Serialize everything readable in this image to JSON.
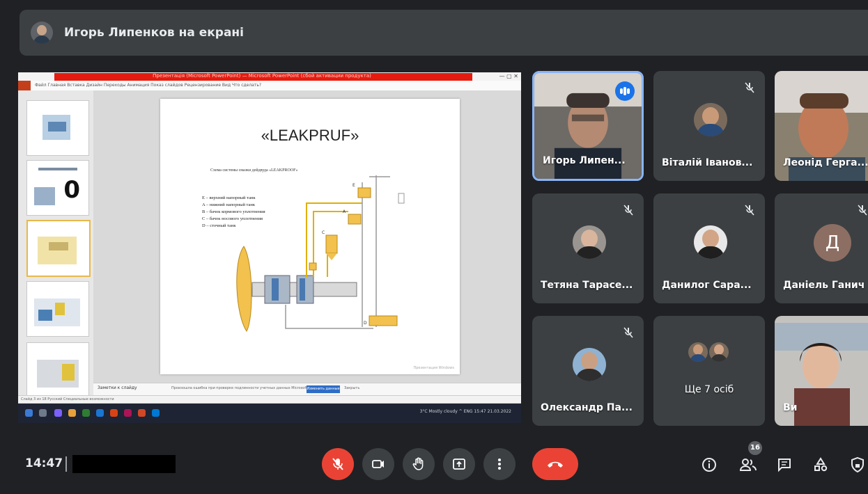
{
  "header": {
    "presenter_title": "Игорь Липенков на екрані"
  },
  "shared_screen": {
    "window_title": "Презентація (Microsoft PowerPoint) — Microsoft PowerPoint (сбой активации продукта)",
    "ribbon_menu": "Файл   Главная   Вставка   Дизайн   Переходы   Анимация   Показ слайдов   Рецензирование   Вид   Что сделать?",
    "slide": {
      "title": "«LEAKPRUF»",
      "subtitle": "Схема системы смазки дейдвуда «LEAKPROOF»",
      "legend": [
        "E – верхний напорный танк",
        "A – нижний напорный танк",
        "B – бачок кормового уплотнения",
        "C – бачок носового уплотнения",
        "D – сточный танк"
      ],
      "footer": "Презентация Windows"
    },
    "notes_label": "Заметки к слайду",
    "notes_message": "Произошла ошибка при проверке подлинности учетных данных Microsoft Office",
    "notes_button": "Изменить данные",
    "notes_button_secondary": "Закрыть",
    "status_text": "Слайд 3 из 18   Русский   Специальные возможности",
    "tray_text": "3°C  Mostly cloudy  ^  ENG  15:47  21.03.2022"
  },
  "participants": [
    {
      "name": "Игорь Липен...",
      "speaking": true
    },
    {
      "name": "Віталій Іванов...",
      "muted": true
    },
    {
      "name": "Леонід Герга...",
      "muted": true
    },
    {
      "name": "Тетяна Тарасе...",
      "muted": true
    },
    {
      "name": "Данилог Сара...",
      "muted": true
    },
    {
      "name": "Даніель Ганич",
      "muted": true,
      "initial": "Д"
    },
    {
      "name": "Олександр Па...",
      "muted": true
    },
    {
      "name": "Ще 7 осіб"
    },
    {
      "name": "Ви"
    }
  ],
  "bottom_bar": {
    "time": "14:47",
    "participants_count": "16"
  },
  "colors": {
    "background": "#202124",
    "tile": "#3c4043",
    "danger": "#ea4335",
    "accent": "#8ab4f8"
  },
  "icons": {
    "mic": "mic-off-icon",
    "camera": "camera-icon",
    "hand": "raise-hand-icon",
    "present": "present-screen-icon",
    "more": "more-vert-icon",
    "end": "end-call-icon",
    "info": "info-icon",
    "people": "people-icon",
    "chat": "chat-icon",
    "activities": "activities-icon",
    "lock": "host-controls-icon"
  }
}
